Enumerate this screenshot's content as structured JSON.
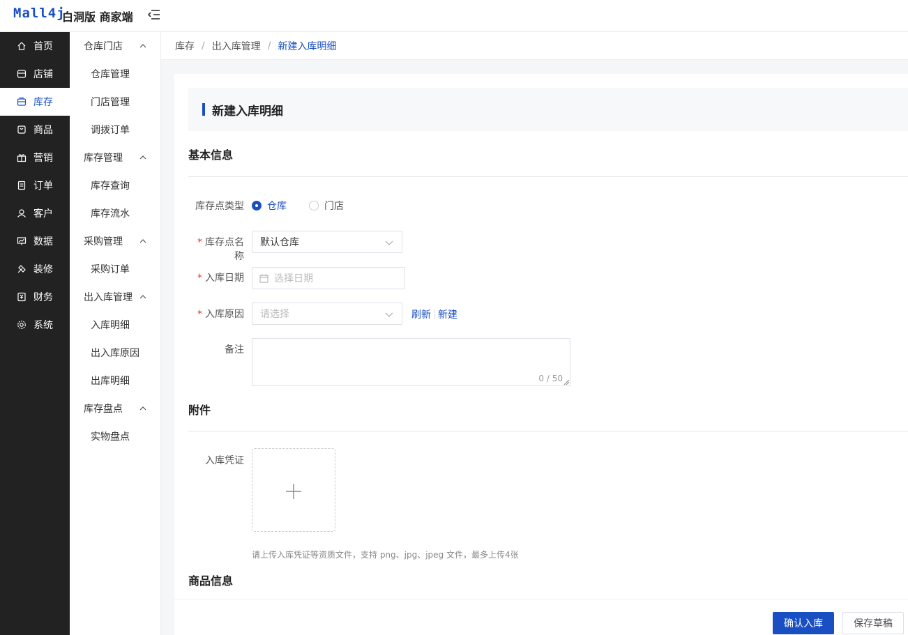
{
  "header": {
    "logo": "Mall4j",
    "brand": "白洞版 商家端"
  },
  "sidebar": {
    "items": [
      {
        "label": "首页",
        "icon": "home-icon"
      },
      {
        "label": "店铺",
        "icon": "shop-icon"
      },
      {
        "label": "库存",
        "icon": "inventory-icon",
        "active": true
      },
      {
        "label": "商品",
        "icon": "product-icon"
      },
      {
        "label": "营销",
        "icon": "gift-icon"
      },
      {
        "label": "订单",
        "icon": "order-icon"
      },
      {
        "label": "客户",
        "icon": "customer-icon"
      },
      {
        "label": "数据",
        "icon": "data-icon"
      },
      {
        "label": "装修",
        "icon": "decorate-icon"
      },
      {
        "label": "财务",
        "icon": "finance-icon"
      },
      {
        "label": "系统",
        "icon": "settings-icon"
      }
    ]
  },
  "submenu": {
    "groups": [
      {
        "label": "仓库门店",
        "items": [
          "仓库管理",
          "门店管理",
          "调拨订单"
        ]
      },
      {
        "label": "库存管理",
        "items": [
          "库存查询",
          "库存流水"
        ]
      },
      {
        "label": "采购管理",
        "items": [
          "采购订单"
        ]
      },
      {
        "label": "出入库管理",
        "items": [
          "入库明细",
          "出入库原因",
          "出库明细"
        ]
      },
      {
        "label": "库存盘点",
        "items": [
          "实物盘点"
        ]
      }
    ]
  },
  "breadcrumb": {
    "items": [
      "库存",
      "出入库管理"
    ],
    "current": "新建入库明细",
    "sep": "/"
  },
  "page": {
    "title": "新建入库明细"
  },
  "basic": {
    "section_title": "基本信息",
    "point_type": {
      "label": "库存点类型",
      "options": [
        "仓库",
        "门店"
      ],
      "selected": "仓库"
    },
    "point_name": {
      "label": "库存点名称",
      "value": "默认仓库",
      "required": "*"
    },
    "date": {
      "label": "入库日期",
      "placeholder": "选择日期",
      "required": "*"
    },
    "reason": {
      "label": "入库原因",
      "placeholder": "请选择",
      "required": "*",
      "refresh": "刷新",
      "new": "新建"
    },
    "remark": {
      "label": "备注",
      "count": "0 / 50"
    }
  },
  "attachment": {
    "section_title": "附件",
    "voucher": {
      "label": "入库凭证"
    },
    "hint": "请上传入库凭证等资质文件，支持 png、jpg、jpeg 文件，最多上传4张"
  },
  "goods": {
    "section_title": "商品信息"
  },
  "footer": {
    "confirm": "确认入库",
    "draft": "保存草稿"
  }
}
